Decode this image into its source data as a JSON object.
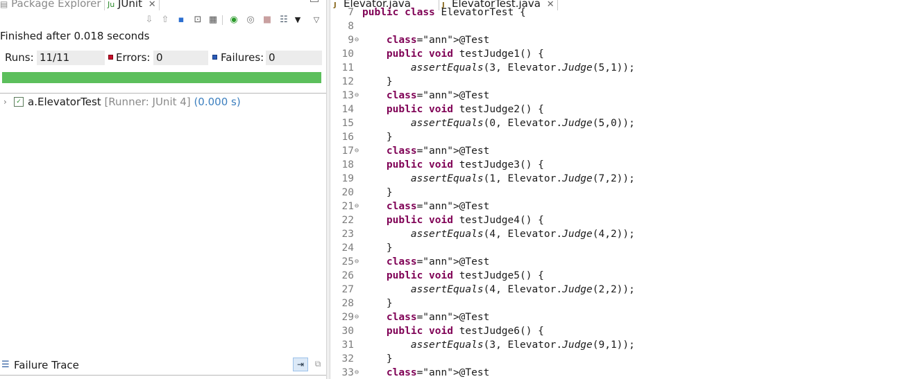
{
  "left_panel": {
    "tabs": {
      "package_explorer": "Package Explorer",
      "junit": "JUnit"
    },
    "status": "Finished after 0.018 seconds",
    "counters": {
      "runs_label": "Runs:",
      "runs_value": "11/11",
      "errors_label": "Errors:",
      "errors_value": "0",
      "failures_label": "Failures:",
      "failures_value": "0"
    },
    "progress_color": "#5cbf5c",
    "progress_fraction": 1.0,
    "tree": {
      "name": "a.ElevatorTest",
      "runner": "[Runner: JUnit 4]",
      "time": "(0.000 s)"
    },
    "failure_trace_label": "Failure Trace"
  },
  "editor": {
    "tabs": {
      "elevator": "Elevator.java",
      "elevator_test": "ElevatorTest.java"
    },
    "lines": [
      {
        "n": "7",
        "text": "public class ElevatorTest {"
      },
      {
        "n": "8",
        "text": ""
      },
      {
        "n": "9",
        "text": "    @Test",
        "fold": true
      },
      {
        "n": "10",
        "text": "    public void testJudge1() {"
      },
      {
        "n": "11",
        "text": "        assertEquals(3, Elevator.Judge(5,1));"
      },
      {
        "n": "12",
        "text": "    }"
      },
      {
        "n": "13",
        "text": "    @Test",
        "fold": true
      },
      {
        "n": "14",
        "text": "    public void testJudge2() {"
      },
      {
        "n": "15",
        "text": "        assertEquals(0, Elevator.Judge(5,0));"
      },
      {
        "n": "16",
        "text": "    }"
      },
      {
        "n": "17",
        "text": "    @Test",
        "fold": true
      },
      {
        "n": "18",
        "text": "    public void testJudge3() {"
      },
      {
        "n": "19",
        "text": "        assertEquals(1, Elevator.Judge(7,2));"
      },
      {
        "n": "20",
        "text": "    }"
      },
      {
        "n": "21",
        "text": "    @Test",
        "fold": true
      },
      {
        "n": "22",
        "text": "    public void testJudge4() {"
      },
      {
        "n": "23",
        "text": "        assertEquals(4, Elevator.Judge(4,2));"
      },
      {
        "n": "24",
        "text": "    }"
      },
      {
        "n": "25",
        "text": "    @Test",
        "fold": true
      },
      {
        "n": "26",
        "text": "    public void testJudge5() {"
      },
      {
        "n": "27",
        "text": "        assertEquals(4, Elevator.Judge(2,2));"
      },
      {
        "n": "28",
        "text": "    }"
      },
      {
        "n": "29",
        "text": "    @Test",
        "fold": true
      },
      {
        "n": "30",
        "text": "    public void testJudge6() {"
      },
      {
        "n": "31",
        "text": "        assertEquals(3, Elevator.Judge(9,1));"
      },
      {
        "n": "32",
        "text": "    }"
      },
      {
        "n": "33",
        "text": "    @Test",
        "fold": true
      }
    ]
  }
}
